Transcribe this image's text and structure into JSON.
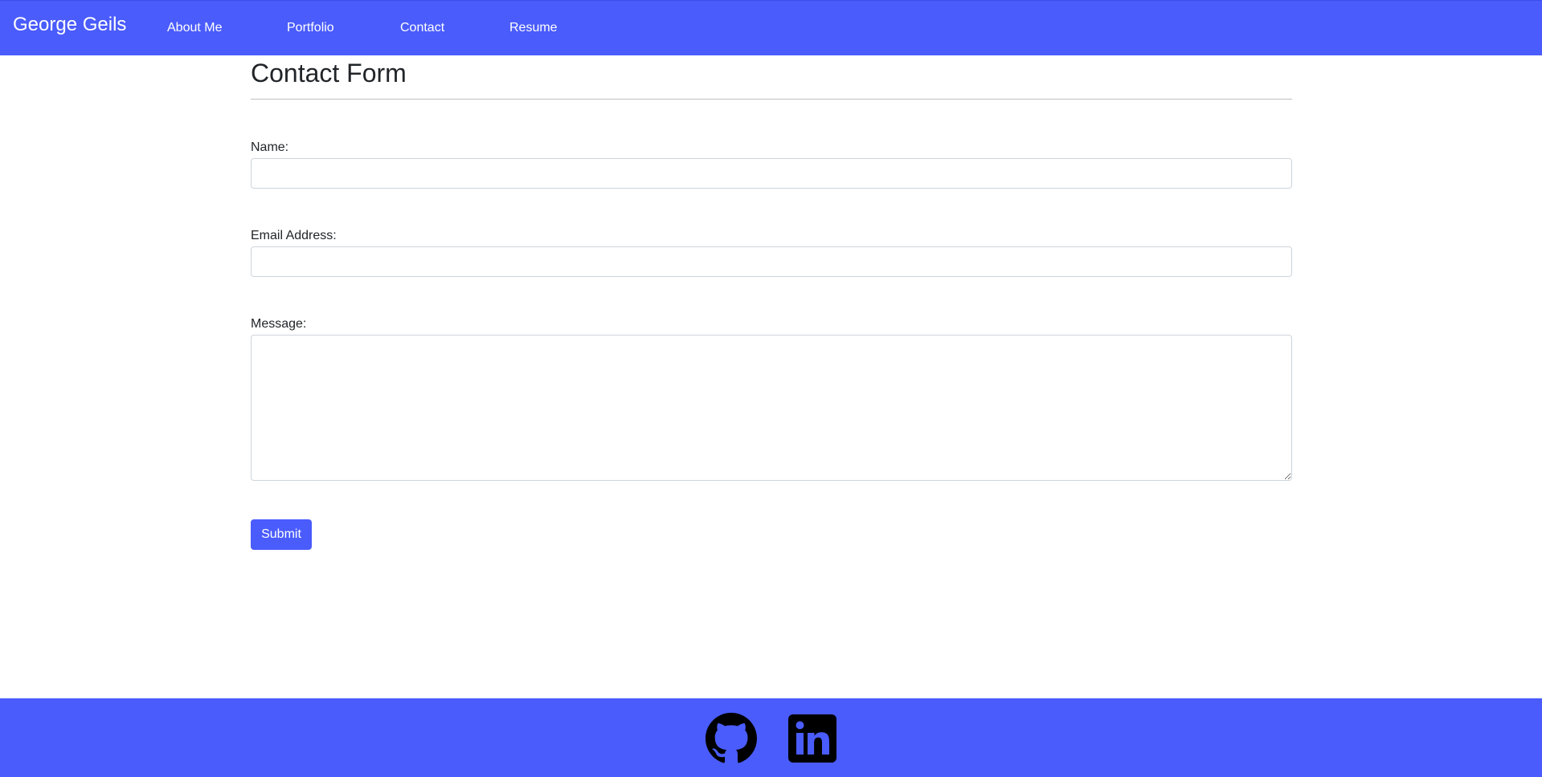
{
  "navbar": {
    "brand": "George Geils",
    "links": [
      {
        "label": "About Me"
      },
      {
        "label": "Portfolio"
      },
      {
        "label": "Contact"
      },
      {
        "label": "Resume"
      }
    ],
    "color": "#4a5cfc"
  },
  "form": {
    "title": "Contact Form",
    "name_label": "Name:",
    "name_value": "",
    "email_label": "Email Address:",
    "email_value": "",
    "message_label": "Message:",
    "message_value": "",
    "submit_label": "Submit"
  },
  "footer": {
    "icons": [
      "github-icon",
      "linkedin-icon"
    ]
  }
}
